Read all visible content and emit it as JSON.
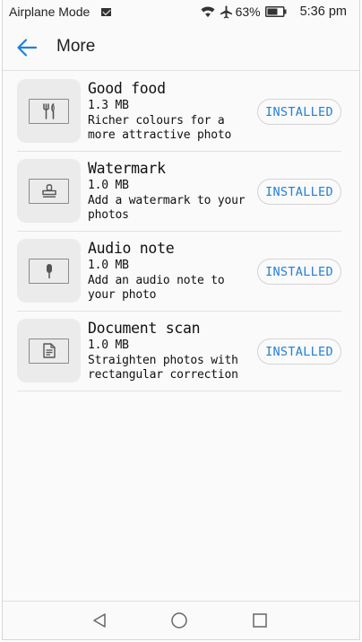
{
  "status_bar": {
    "mode_label": "Airplane Mode",
    "battery_percent": "63%",
    "time": "5:36 pm",
    "icons": [
      "mail-icon",
      "wifi-icon",
      "airplane-icon",
      "battery-icon"
    ]
  },
  "header": {
    "title": "More",
    "back_icon": "arrow-back-icon"
  },
  "colors": {
    "accent": "#2380d8",
    "background": "#fafafa",
    "thumb_bg": "#ebebeb"
  },
  "items": [
    {
      "name": "Good food",
      "size": "1.3 MB",
      "description": "Richer colours for a more attractive photo",
      "button_label": "INSTALLED",
      "icon": "fork-knife-icon"
    },
    {
      "name": "Watermark",
      "size": "1.0 MB",
      "description": "Add a watermark to your photos",
      "button_label": "INSTALLED",
      "icon": "stamp-icon"
    },
    {
      "name": "Audio note",
      "size": "1.0 MB",
      "description": "Add an audio note to your photo",
      "button_label": "INSTALLED",
      "icon": "microphone-icon"
    },
    {
      "name": "Document scan",
      "size": "1.0 MB",
      "description": "Straighten photos with rectangular correction",
      "button_label": "INSTALLED",
      "icon": "document-icon"
    }
  ],
  "nav_bar": {
    "buttons": [
      "back-triangle-icon",
      "home-circle-icon",
      "recents-square-icon"
    ]
  }
}
